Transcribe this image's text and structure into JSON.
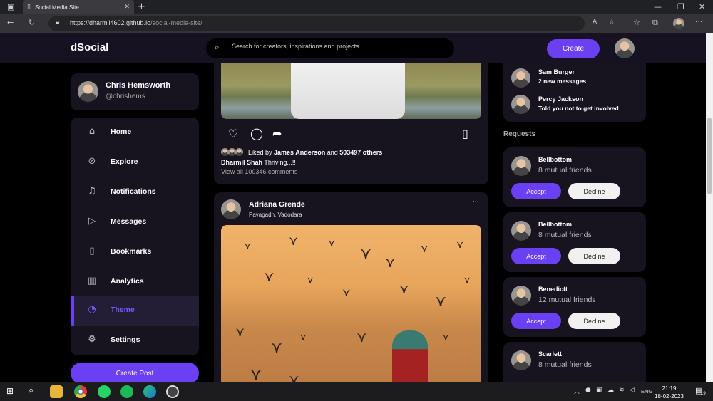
{
  "browser": {
    "tab_title": "Social Media Site",
    "url_host": "https://dharmil4602.github.io",
    "url_path": "/social-media-site/"
  },
  "nav": {
    "logo": "dSocial",
    "search_placeholder": "Search for creators, inspirations and projects",
    "create_label": "Create"
  },
  "profile": {
    "name": "Chris Hemsworth",
    "handle": "@chrishems"
  },
  "sidebar": {
    "items": [
      {
        "label": "Home",
        "icon": "home-icon"
      },
      {
        "label": "Explore",
        "icon": "compass-icon"
      },
      {
        "label": "Notifications",
        "icon": "bell-icon"
      },
      {
        "label": "Messages",
        "icon": "send-icon"
      },
      {
        "label": "Bookmarks",
        "icon": "bookmark-icon"
      },
      {
        "label": "Analytics",
        "icon": "chart-icon"
      },
      {
        "label": "Theme",
        "icon": "palette-icon"
      },
      {
        "label": "Settings",
        "icon": "gear-icon"
      }
    ],
    "active": "Theme",
    "create_post_label": "Create Post"
  },
  "feed": {
    "post1": {
      "liked_prefix": "Liked by ",
      "liked_by": "James Anderson",
      "liked_and": " and ",
      "liked_others": "503497 others",
      "author": "Dharmil Shah",
      "caption": " Thriving...!!",
      "comments": "View all 100346 comments"
    },
    "post2": {
      "author": "Adriana Grende",
      "location": "Pavagadh, Vadodara",
      "more": "···"
    }
  },
  "messages": [
    {
      "name": "Sam Burger",
      "text": "2 new messages"
    },
    {
      "name": "Percy Jackson",
      "text": "Told you not to get involved"
    }
  ],
  "requests": {
    "title": "Requests",
    "accept_label": "Accept",
    "decline_label": "Decline",
    "items": [
      {
        "name": "Bellbottom",
        "mutual": "8 mutual friends"
      },
      {
        "name": "Bellbottom",
        "mutual": "8 mutual friends"
      },
      {
        "name": "Benedictt",
        "mutual": "12 mutual friends"
      },
      {
        "name": "Scarlett",
        "mutual": "8 mutual friends"
      }
    ]
  },
  "taskbar": {
    "lang": "ENG",
    "time": "21:19",
    "date": "18-02-2023",
    "notif_count": "19"
  },
  "colors": {
    "accent": "#6b3ff2",
    "background": "#000000",
    "card": "#17131f"
  }
}
